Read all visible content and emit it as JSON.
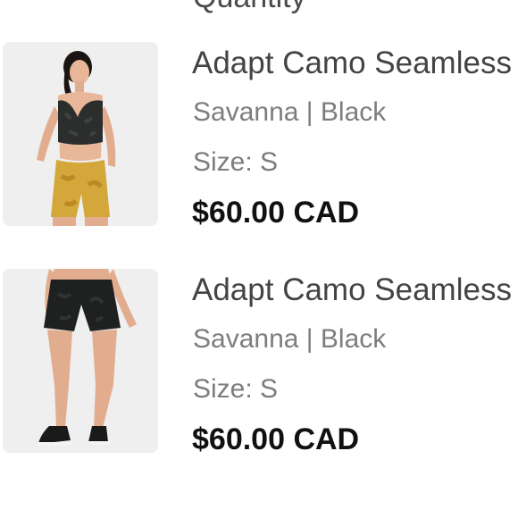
{
  "cart": {
    "items": [
      {
        "title": "Adapt Camo Seamless Sports Bra",
        "variant": "Savanna | Black",
        "size": "Size: S",
        "price": "$60.00 CAD"
      },
      {
        "title": "Adapt Camo Seamless Shorts",
        "variant": "Savanna | Black",
        "size": "Size: S",
        "price": "$60.00 CAD"
      }
    ]
  },
  "colors": {
    "thumb_background": "#efefef",
    "title": "#444444",
    "secondary_text": "#7d7d7d",
    "price": "#111111"
  }
}
